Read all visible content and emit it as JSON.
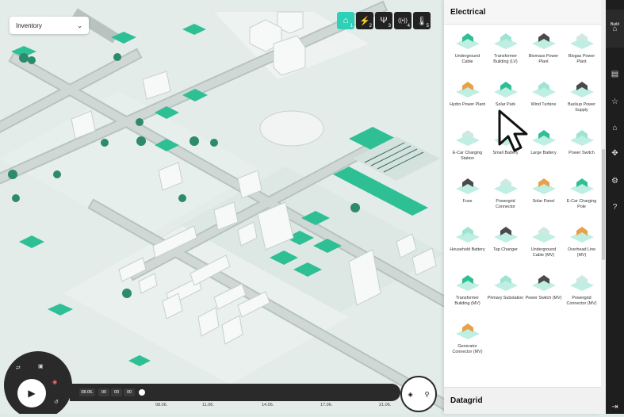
{
  "inventory": {
    "label": "Inventory"
  },
  "toolbar": [
    {
      "icon": "home-icon",
      "glyph": "⌂",
      "num": "1"
    },
    {
      "icon": "lightning-icon",
      "glyph": "⚡",
      "num": "2"
    },
    {
      "icon": "antenna-icon",
      "glyph": "Ψ",
      "num": "3"
    },
    {
      "icon": "signal-icon",
      "glyph": "((•))",
      "num": "4"
    },
    {
      "icon": "thermometer-icon",
      "glyph": "🌡",
      "num": "5"
    }
  ],
  "panel": {
    "title": "Electrical",
    "footer": "Datagrid",
    "items": [
      {
        "label": "Underground Cable",
        "icon": "cable-icon"
      },
      {
        "label": "Transformer Building (LV)",
        "icon": "transformer-icon"
      },
      {
        "label": "Biomass Power Plant",
        "icon": "biomass-plant-icon"
      },
      {
        "label": "Biogas Power Plant",
        "icon": "biogas-plant-icon"
      },
      {
        "label": "Hydro Power Plant",
        "icon": "hydro-plant-icon"
      },
      {
        "label": "Solar Park",
        "icon": "solar-park-icon"
      },
      {
        "label": "Wind Turbine",
        "icon": "wind-turbine-icon"
      },
      {
        "label": "Backup Power Supply",
        "icon": "backup-power-icon"
      },
      {
        "label": "E-Car Charging Station",
        "icon": "ecar-station-icon"
      },
      {
        "label": "Small Battery",
        "icon": "small-battery-icon"
      },
      {
        "label": "Large Battery",
        "icon": "large-battery-icon"
      },
      {
        "label": "Power Switch",
        "icon": "power-switch-icon"
      },
      {
        "label": "Fuse",
        "icon": "fuse-icon"
      },
      {
        "label": "Powergrid Connector",
        "icon": "powergrid-connector-icon"
      },
      {
        "label": "Solar Panel",
        "icon": "solar-panel-icon"
      },
      {
        "label": "E-Car Charging Pole",
        "icon": "ecar-pole-icon"
      },
      {
        "label": "Household Battery",
        "icon": "household-battery-icon"
      },
      {
        "label": "Tap Changer",
        "icon": "tap-changer-icon"
      },
      {
        "label": "Underground Cable (MV)",
        "icon": "cable-mv-icon"
      },
      {
        "label": "Overhead Line (MV)",
        "icon": "overhead-line-icon"
      },
      {
        "label": "Transformer Building (MV)",
        "icon": "transformer-mv-icon"
      },
      {
        "label": "Primary Substation",
        "icon": "substation-icon"
      },
      {
        "label": "Power Switch (MV)",
        "icon": "power-switch-mv-icon"
      },
      {
        "label": "Powergrid Connector (MV)",
        "icon": "powergrid-connector-mv-icon"
      },
      {
        "label": "Generator Connector (MV)",
        "icon": "generator-connector-icon"
      }
    ]
  },
  "rail": {
    "building_label": "Build"
  },
  "time": {
    "date": "08.06.",
    "h": "00",
    "m": "00",
    "s": "00"
  },
  "dates": [
    "08.06.",
    "11.06.",
    "14.06.",
    "17.06.",
    "21.06."
  ],
  "colors": {
    "accent": "#2fd0b8",
    "green": "#2fbf95",
    "dark": "#1e1e1e"
  }
}
